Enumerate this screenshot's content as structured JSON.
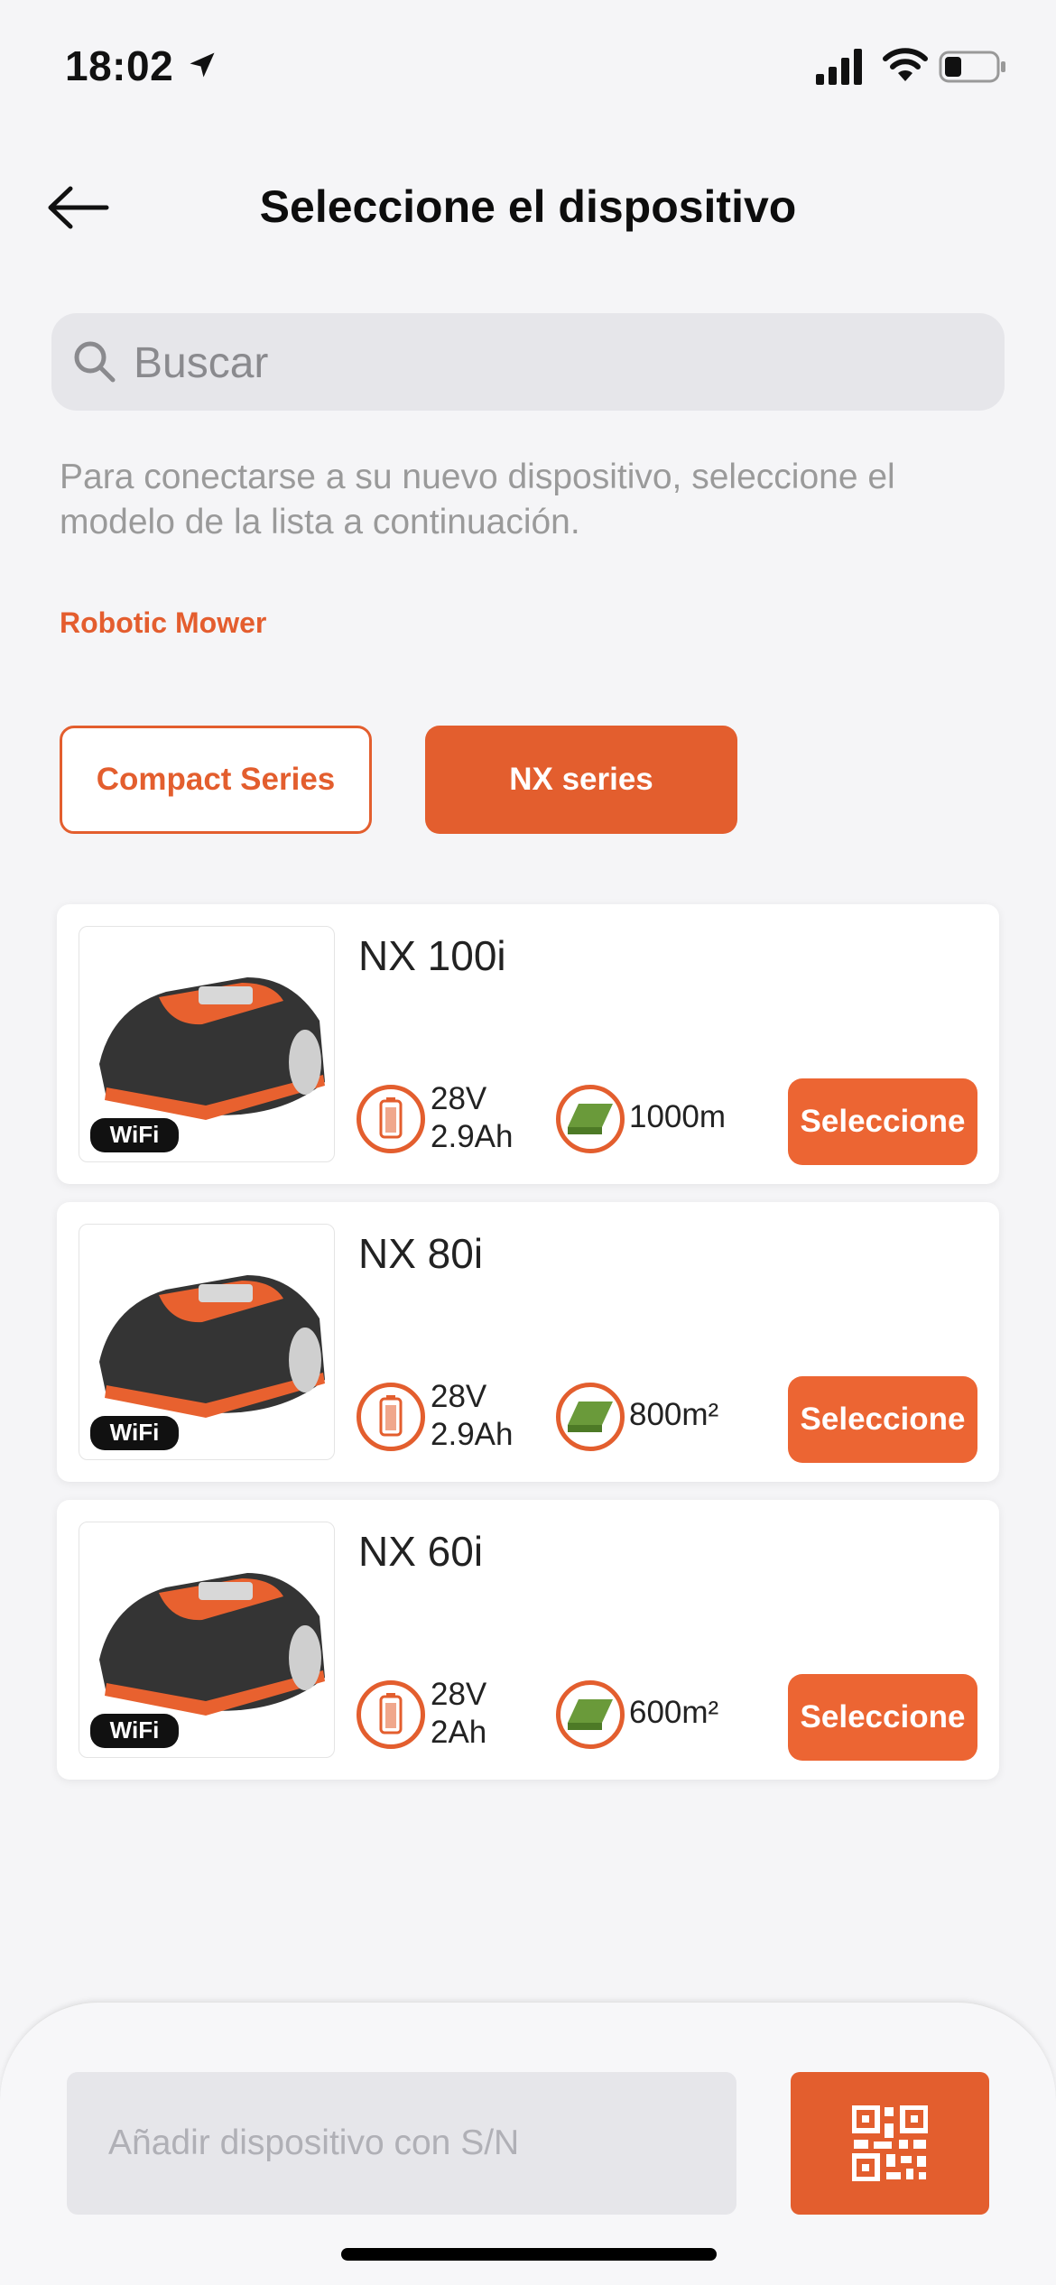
{
  "status_bar": {
    "time": "18:02"
  },
  "header": {
    "title": "Seleccione el dispositivo"
  },
  "search": {
    "placeholder": "Buscar"
  },
  "hint": "Para conectarse a su nuevo dispositivo, seleccione el modelo de la lista a continuación.",
  "category": "Robotic Mower",
  "tabs": [
    {
      "label": "Compact Series",
      "active": false
    },
    {
      "label": "NX series",
      "active": true
    }
  ],
  "devices": [
    {
      "name": "NX 100i",
      "voltage": "28V",
      "capacity": "2.9Ah",
      "area": "1000m",
      "badge": "WiFi",
      "button": "Seleccione"
    },
    {
      "name": "NX 80i",
      "voltage": "28V",
      "capacity": "2.9Ah",
      "area": "800m²",
      "badge": "WiFi",
      "button": "Seleccione"
    },
    {
      "name": "NX 60i",
      "voltage": "28V",
      "capacity": "2Ah",
      "area": "600m²",
      "badge": "WiFi",
      "button": "Seleccione"
    }
  ],
  "footer": {
    "sn_placeholder": "Añadir dispositivo con S/N"
  },
  "colors": {
    "accent": "#e35e2e",
    "background": "#f5f5f7"
  }
}
